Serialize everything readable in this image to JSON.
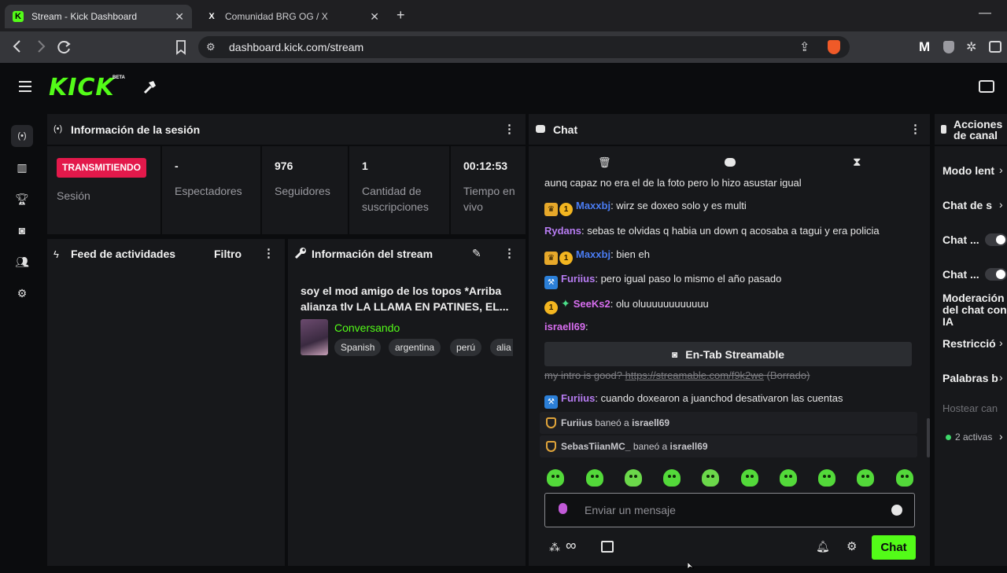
{
  "browser": {
    "tabs": [
      {
        "title": "Stream - Kick Dashboard",
        "favicon": "K"
      },
      {
        "title": "Comunidad BRG OG / X",
        "favicon": "X"
      }
    ],
    "url": "dashboard.kick.com/stream"
  },
  "app": {
    "logo": "KICK",
    "logo_badge": "BETA",
    "accent": "#53fc18"
  },
  "session": {
    "title": "Información de la sesión",
    "status": "TRANSMITIENDO",
    "status_label": "Sesión",
    "stats": [
      {
        "value": "-",
        "label": "Espectadores"
      },
      {
        "value": "976",
        "label": "Seguidores"
      },
      {
        "value": "1",
        "label": "Cantidad de suscripciones"
      },
      {
        "value": "00:12:53",
        "label": "Tiempo en vivo"
      }
    ]
  },
  "activity": {
    "title": "Feed de actividades",
    "filter": "Filtro"
  },
  "stream_info": {
    "title": "Información del stream",
    "stream_title": "soy el mod amigo de los topos *Arriba alianza tlv LA LLAMA EN PATINES, EL...",
    "category": "Conversando",
    "tags": [
      "Spanish",
      "argentina",
      "perú",
      "alia"
    ]
  },
  "chat": {
    "title": "Chat",
    "messages": [
      {
        "text": "aunq capaz no era el de la foto pero lo hizo asustar igual"
      },
      {
        "user": "Maxxbj",
        "text": ": wirz se doxeo solo y es multi"
      },
      {
        "user": "Rydans",
        "text": ": sebas te olvidas q habia un down q acosaba a tagui y era policia"
      },
      {
        "user": "Maxxbj",
        "text": ": bien eh"
      },
      {
        "user": "Furiius",
        "text": ": pero igual paso lo mismo el año pasado"
      },
      {
        "user": "SeeKs2",
        "text": ": olu oluuuuuuuuuuuu"
      },
      {
        "user": "israell69",
        "text": ":"
      },
      {
        "text": "my intro is good? ",
        "link": "https://streamable.com/f9k2we",
        "suffix": " (Borrado)"
      },
      {
        "user": "Furiius",
        "text": ": cuando doxearon a juanchod desativaron las cuentas"
      }
    ],
    "embed_button": "En-Tab Streamable",
    "mod_actions": [
      {
        "mod": "Furiius",
        "action": " baneó a ",
        "target": "israell69"
      },
      {
        "mod": "SebasTiianMC_",
        "action": " baneó a ",
        "target": "israell69"
      }
    ],
    "input_placeholder": "Enviar un mensaje",
    "send_label": "Chat",
    "infinity": "∞"
  },
  "channel_actions": {
    "title": "Acciones de canal",
    "items": [
      "Modo lent",
      "Chat de s",
      "Chat ...",
      "Chat ...",
      "Moderación del chat con IA",
      "Restricció",
      "Palabras b",
      "Hostear can"
    ],
    "active_count": "2 activas"
  }
}
